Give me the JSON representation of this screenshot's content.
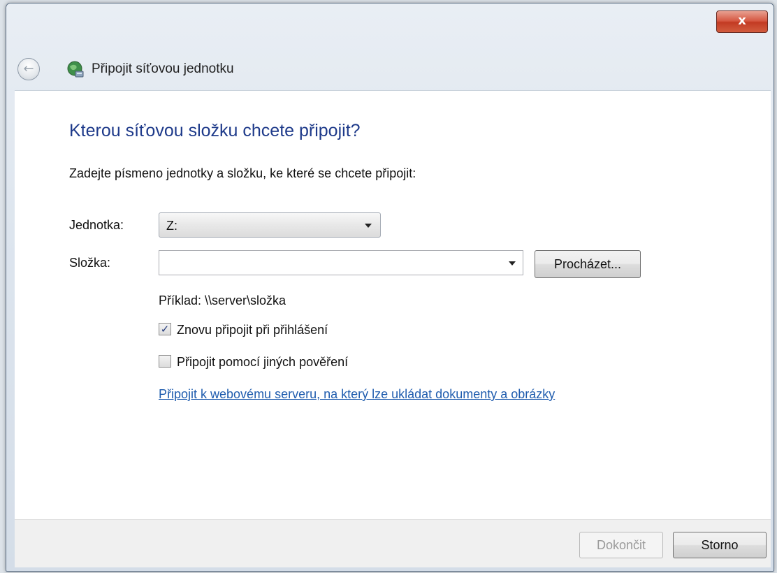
{
  "window": {
    "title": "Připojit síťovou jednotku",
    "close_label": "x",
    "back_label": "←"
  },
  "heading": "Kterou síťovou složku chcete připojit?",
  "instruction": "Zadejte písmeno jednotky a složku, ke které se chcete připojit:",
  "drive": {
    "label": "Jednotka:",
    "value": "Z:"
  },
  "folder": {
    "label": "Složka:",
    "value": "",
    "placeholder": ""
  },
  "browse_label": "Procházet...",
  "example": "Příklad: \\\\server\\složka",
  "options": [
    {
      "label": "Znovu připojit při přihlášení",
      "checked": true,
      "mark": "✓"
    },
    {
      "label": "Připojit pomocí jiných pověření",
      "checked": false,
      "mark": ""
    }
  ],
  "web_link": "Připojit k webovému serveru, na který lze ukládat dokumenty a obrázky",
  "footer": {
    "finish_label": "Dokončit",
    "cancel_label": "Storno"
  },
  "colors": {
    "heading": "#1e3a8a",
    "link": "#1f5cae",
    "close": "#c23a22"
  }
}
